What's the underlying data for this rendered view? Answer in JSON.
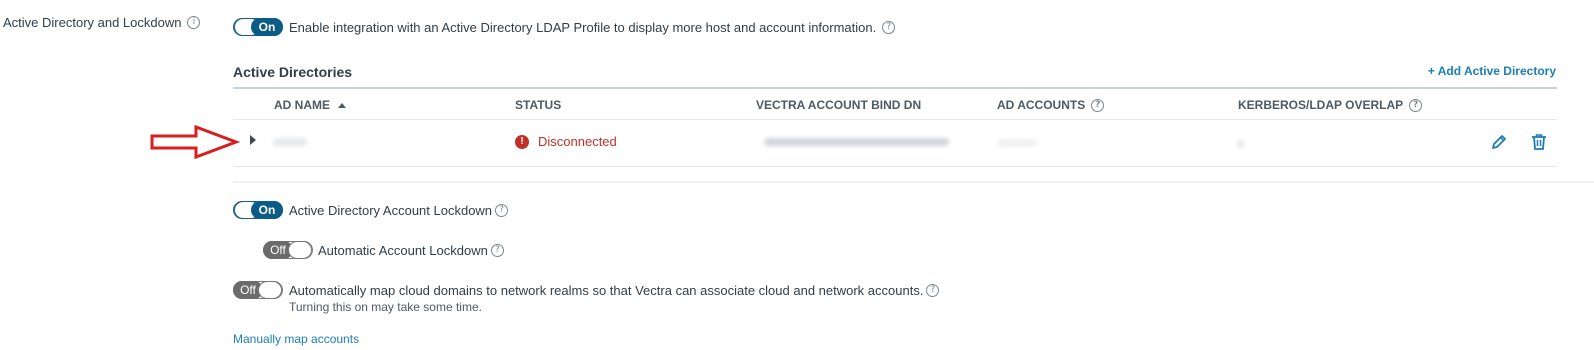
{
  "section": {
    "label": "Active Directory and Lockdown",
    "help_icon": "info-icon"
  },
  "integration": {
    "toggle_label": "On",
    "text": "Enable integration with an Active Directory LDAP Profile to display more host and account information."
  },
  "directories": {
    "heading": "Active Directories",
    "add_label": "+ Add Active Directory",
    "columns": [
      "AD NAME",
      "STATUS",
      "VECTRA ACCOUNT BIND DN",
      "AD ACCOUNTS",
      "KERBEROS/LDAP OVERLAP"
    ],
    "rows": [
      {
        "status": "Disconnected",
        "status_color": "#c0302a"
      }
    ]
  },
  "lockdown": {
    "toggle_label": "On",
    "text": "Active Directory Account Lockdown"
  },
  "auto_lockdown": {
    "toggle_label": "Off",
    "text": "Automatic Account Lockdown"
  },
  "cloud_map": {
    "toggle_label": "Off",
    "text": "Automatically map cloud domains to network realms so that Vectra can associate cloud and network accounts.",
    "note": "Turning this on may take some time."
  },
  "manual_map_link": "Manually map accounts",
  "colors": {
    "accent": "#0b5c86",
    "link": "#1a7fb5",
    "arrow": "#d61f1f",
    "error": "#c0302a"
  }
}
